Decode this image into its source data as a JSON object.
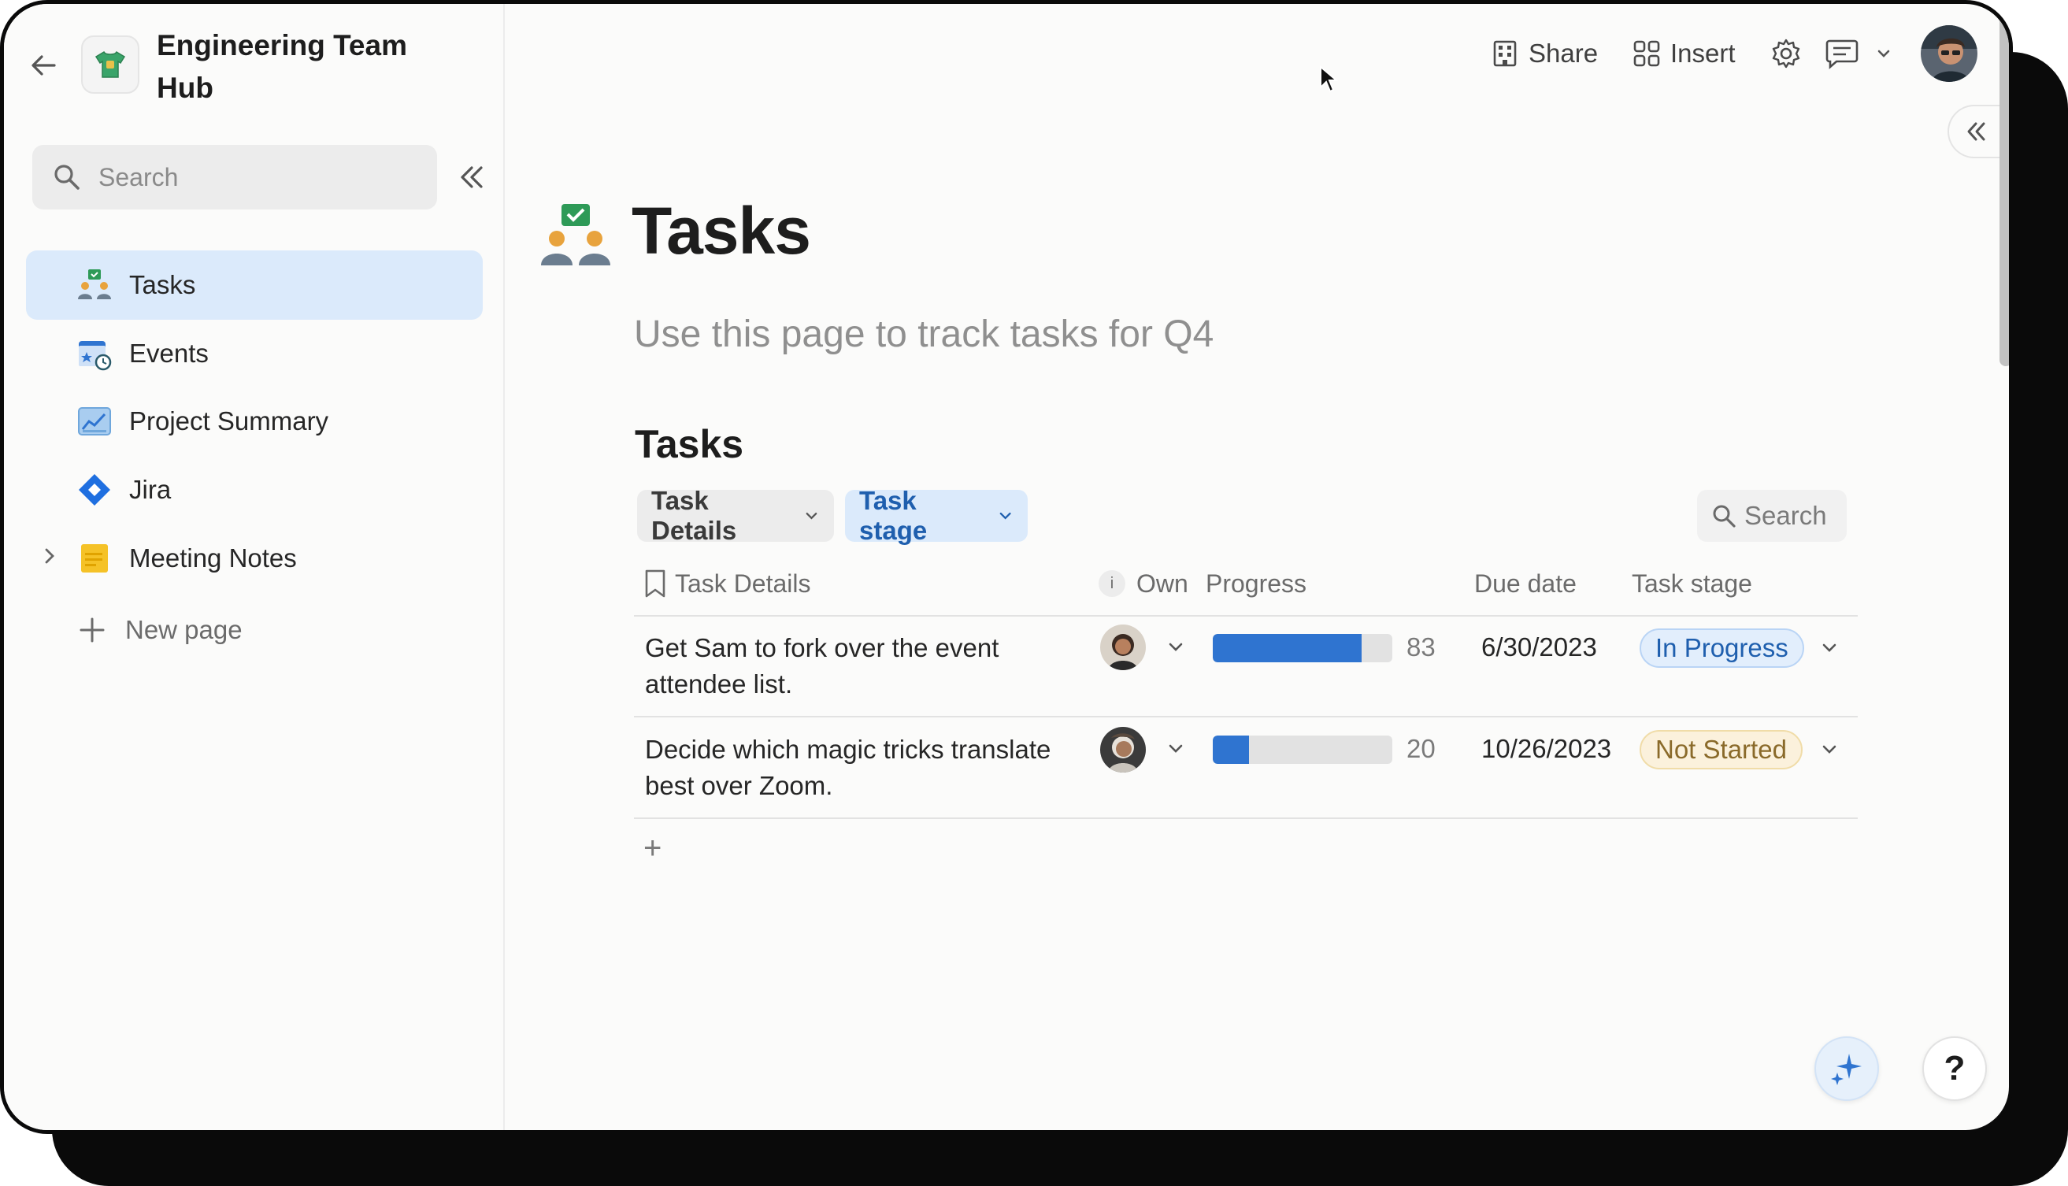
{
  "sidebar": {
    "doc_title": "Engineering Team Hub",
    "search_placeholder": "Search",
    "items": [
      {
        "label": "Tasks",
        "icon": "team-check-icon",
        "active": true
      },
      {
        "label": "Events",
        "icon": "calendar-clock-icon",
        "active": false
      },
      {
        "label": "Project Summary",
        "icon": "chart-icon",
        "active": false
      },
      {
        "label": "Jira",
        "icon": "jira-diamond-icon",
        "active": false
      },
      {
        "label": "Meeting Notes",
        "icon": "sticky-note-icon",
        "active": false,
        "expandable": true
      }
    ],
    "new_page_label": "New page"
  },
  "topbar": {
    "share_label": "Share",
    "insert_label": "Insert"
  },
  "page": {
    "title": "Tasks",
    "subtitle": "Use this page to track tasks for Q4"
  },
  "table": {
    "section_title": "Tasks",
    "filters": {
      "details_label": "Task Details",
      "stage_label": "Task stage"
    },
    "search_label": "Search",
    "columns": {
      "details": "Task Details",
      "owner_icon_text": "i",
      "owner": "Own",
      "progress": "Progress",
      "due": "Due date",
      "stage": "Task stage"
    },
    "rows": [
      {
        "details": "Get Sam to fork over the event attendee list.",
        "progress": 83,
        "due": "6/30/2023",
        "stage": "In Progress"
      },
      {
        "details": "Decide which magic tricks translate best over Zoom.",
        "progress": 20,
        "due": "10/26/2023",
        "stage": "Not Started"
      }
    ],
    "add_row_label": "+"
  },
  "help_label": "?",
  "colors": {
    "accent": "#2f74d0",
    "active_nav": "#dbeafb",
    "in_progress_text": "#1f5fae",
    "not_started_text": "#8a6a2a"
  }
}
